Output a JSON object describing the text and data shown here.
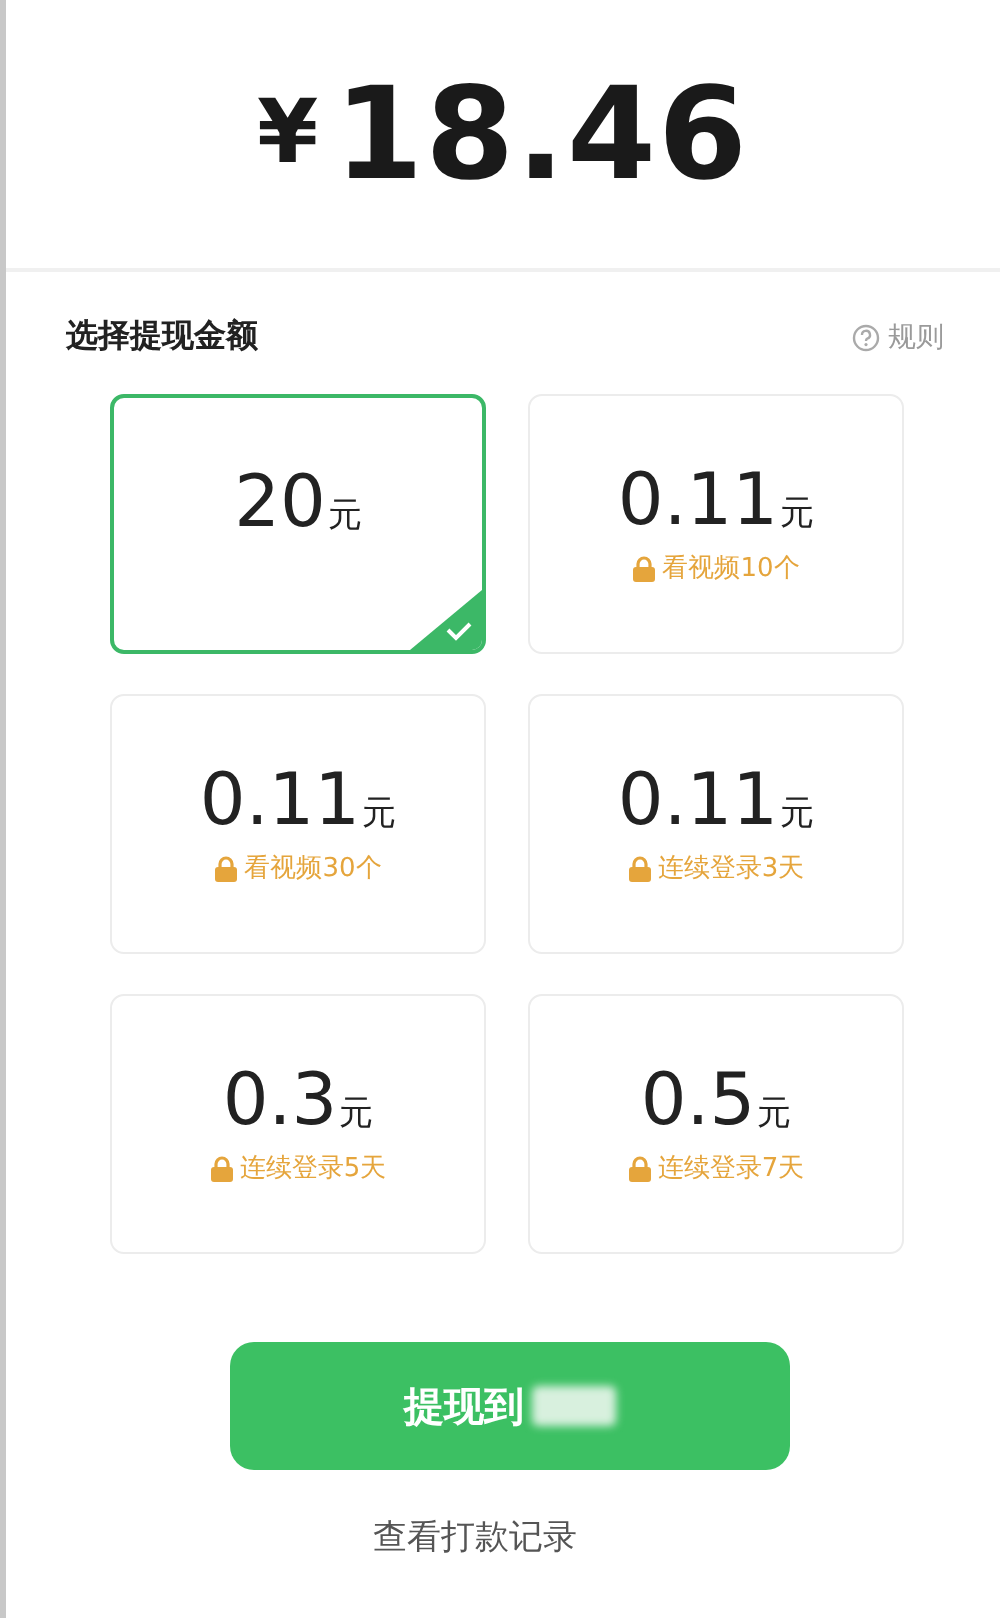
{
  "balance": {
    "currency": "¥",
    "amount": "18.46"
  },
  "section": {
    "title": "选择提现金额",
    "rules_link": "规则"
  },
  "options": [
    {
      "amount": "20",
      "unit": "元",
      "selected": true
    },
    {
      "amount": "0.11",
      "unit": "元",
      "condition": "看视频10个",
      "selected": false
    },
    {
      "amount": "0.11",
      "unit": "元",
      "condition": "看视频30个",
      "selected": false
    },
    {
      "amount": "0.11",
      "unit": "元",
      "condition": "连续登录3天",
      "selected": false
    },
    {
      "amount": "0.3",
      "unit": "元",
      "condition": "连续登录5天",
      "selected": false
    },
    {
      "amount": "0.5",
      "unit": "元",
      "condition": "连续登录7天",
      "selected": false
    }
  ],
  "withdraw_button": "提现到",
  "records_link": "查看打款记录"
}
